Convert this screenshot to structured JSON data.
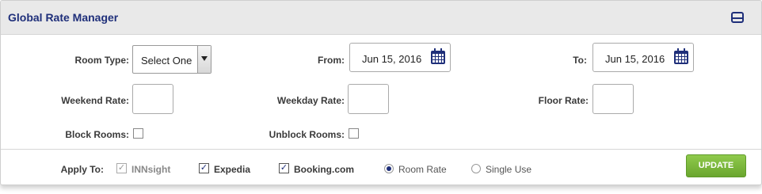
{
  "header": {
    "title": "Global Rate Manager",
    "collapse_icon": "collapse-icon"
  },
  "room_type": {
    "label": "Room Type:",
    "value": "Select One"
  },
  "from": {
    "label": "From:",
    "value": "Jun 15, 2016",
    "icon": "calendar-icon"
  },
  "to": {
    "label": "To:",
    "value": "Jun 15, 2016",
    "icon": "calendar-icon"
  },
  "weekend_rate": {
    "label": "Weekend Rate:",
    "value": ""
  },
  "weekday_rate": {
    "label": "Weekday Rate:",
    "value": ""
  },
  "floor_rate": {
    "label": "Floor Rate:",
    "value": ""
  },
  "block_rooms": {
    "label": "Block Rooms:",
    "checked": false
  },
  "unblock_rooms": {
    "label": "Unblock Rooms:",
    "checked": false
  },
  "apply_to": {
    "label": "Apply To:",
    "channels": [
      {
        "label": "INNsight",
        "checked": true,
        "disabled": true
      },
      {
        "label": "Expedia",
        "checked": true,
        "disabled": false
      },
      {
        "label": "Booking.com",
        "checked": true,
        "disabled": false
      }
    ],
    "rate_options": [
      {
        "label": "Room Rate",
        "selected": true
      },
      {
        "label": "Single Use",
        "selected": false
      }
    ]
  },
  "update_button": "UPDATE",
  "colors": {
    "accent": "#1f2f7a",
    "button_green": "#7ab83b",
    "header_bg": "#e9e9e9"
  }
}
